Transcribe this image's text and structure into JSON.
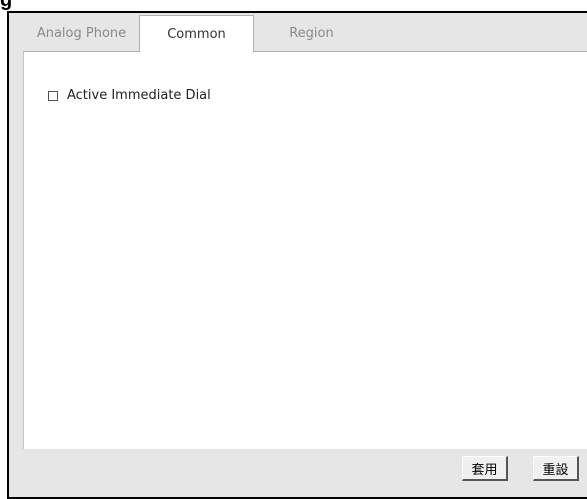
{
  "figure_label": "g",
  "tabs": [
    {
      "label": "Analog Phone",
      "active": false
    },
    {
      "label": "Common",
      "active": true
    },
    {
      "label": "Region",
      "active": false
    }
  ],
  "options": {
    "active_immediate_dial": {
      "label": "Active Immediate Dial",
      "checked": false
    }
  },
  "buttons": {
    "apply_label": "套用",
    "reset_label": "重設"
  }
}
